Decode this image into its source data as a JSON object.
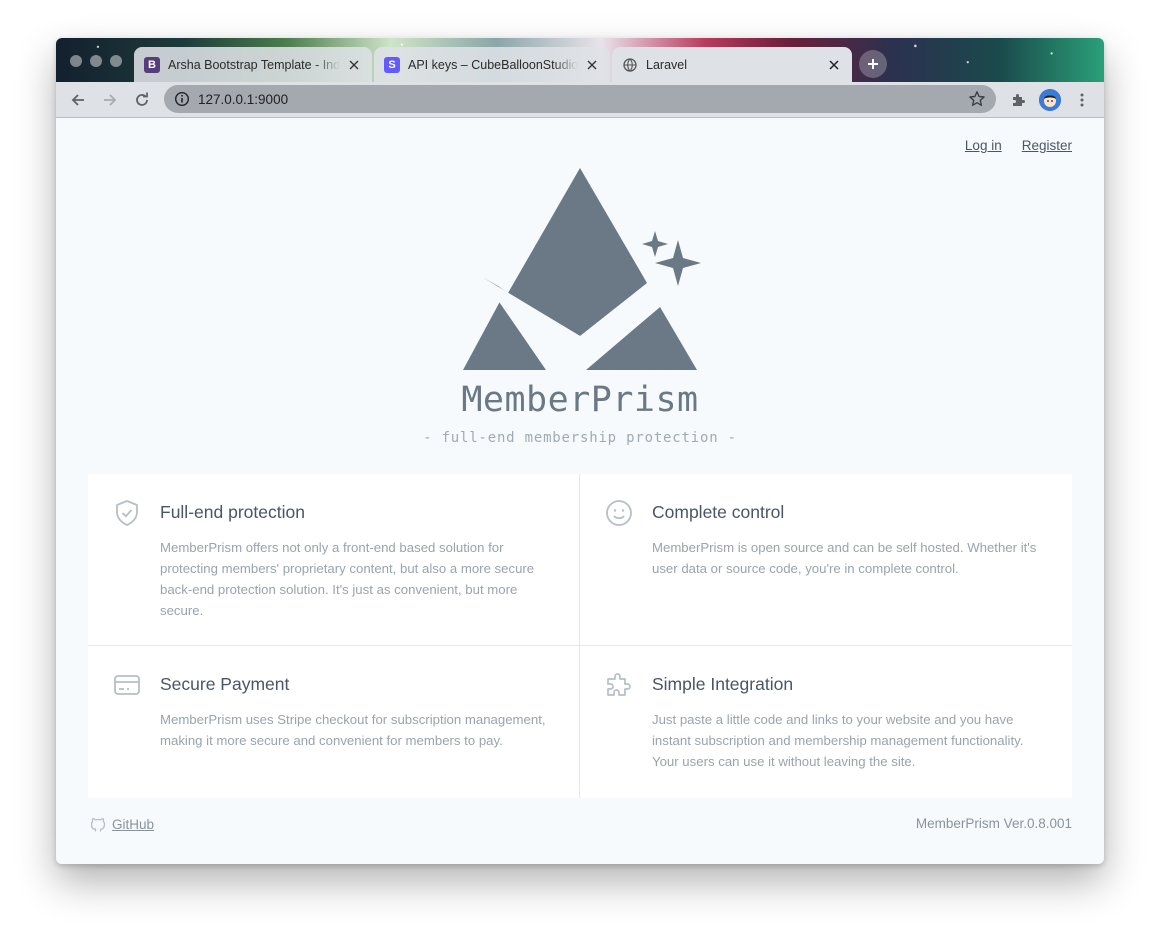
{
  "browser": {
    "tabs": [
      {
        "title": "Arsha Bootstrap Template - Index",
        "favicon_letter": "B",
        "favicon_color": "#563d7c",
        "active": false
      },
      {
        "title": "API keys – CubeBalloonStudio – Stripe",
        "favicon_letter": "S",
        "favicon_color": "#635bff",
        "active": false
      },
      {
        "title": "Laravel",
        "favicon_icon": "globe-icon",
        "active": true
      }
    ],
    "url": "127.0.0.1:9000"
  },
  "nav": {
    "login": "Log in",
    "register": "Register"
  },
  "hero": {
    "brand": "MemberPrism",
    "tagline": "- full-end membership protection -",
    "logo_color": "#6b7885"
  },
  "features": [
    {
      "icon": "shield-check-icon",
      "title": "Full-end protection",
      "text": "MemberPrism offers not only a front-end based solution for protecting members' proprietary content, but also a more secure back-end protection solution. It's just as convenient, but more secure."
    },
    {
      "icon": "smiley-face-icon",
      "title": "Complete control",
      "text": "MemberPrism is open source and can be self hosted. Whether it's user data or source code, you're in complete control."
    },
    {
      "icon": "credit-card-icon",
      "title": "Secure Payment",
      "text": "MemberPrism uses Stripe checkout for subscription management, making it more secure and convenient for members to pay."
    },
    {
      "icon": "puzzle-piece-icon",
      "title": "Simple Integration",
      "text": "Just paste a little code and links to your website and you have instant subscription and membership management functionality. Your users can use it without leaving the site."
    }
  ],
  "footer": {
    "github": "GitHub",
    "version": "MemberPrism Ver.0.8.001"
  },
  "colors": {
    "page_bg": "#f7fafc",
    "card_bg": "#ffffff",
    "text_dark": "#4a5568",
    "text_muted": "#9aa3ad"
  }
}
